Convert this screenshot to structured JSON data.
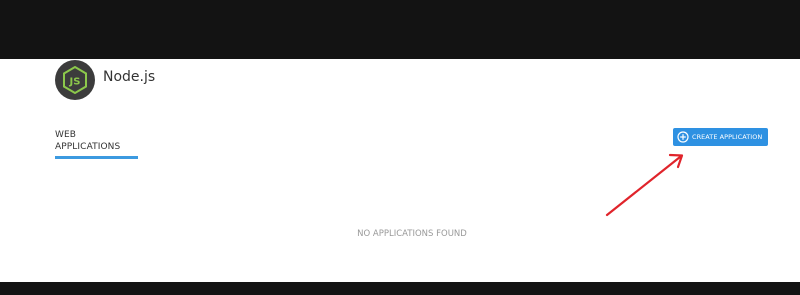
{
  "app": {
    "title": "Node.js",
    "logo_icon": "nodejs-logo-icon",
    "logo_text": "JS"
  },
  "tabs": {
    "web_applications": "WEB APPLICATIONS"
  },
  "toolbar": {
    "create_label": "CREATE APPLICATION",
    "create_icon": "plus-circle-icon"
  },
  "empty_state": {
    "message": "NO APPLICATIONS FOUND"
  },
  "annotation": {
    "icon": "red-arrow-icon",
    "color": "#e0242b"
  },
  "colors": {
    "accent": "#2e91e2",
    "tab_underline": "#3c9ae0",
    "node_green": "#8cc84b",
    "frame_dark": "#131313"
  }
}
